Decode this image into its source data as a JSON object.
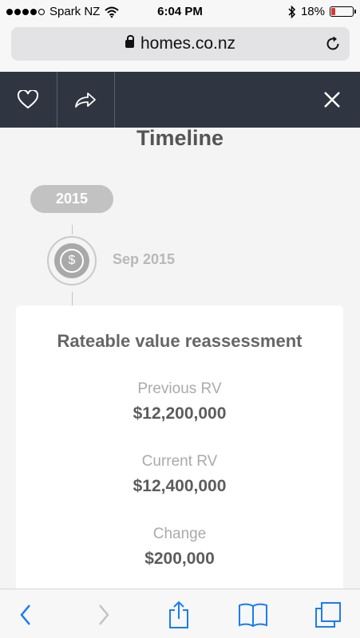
{
  "status": {
    "carrier": "Spark NZ",
    "time": "6:04 PM",
    "battery_percent": "18%",
    "battery_level": 0.18,
    "battery_color": "#e33333"
  },
  "browser": {
    "url": "homes.co.nz"
  },
  "header": {
    "background": "#2f3641",
    "icons": [
      "heart-icon",
      "share-icon",
      "close-icon"
    ]
  },
  "timeline": {
    "title": "Timeline",
    "year": "2015",
    "event_date": "Sep 2015",
    "event_icon": "dollar-coin-icon"
  },
  "card": {
    "title": "Rateable value reassessment",
    "rows": [
      {
        "label": "Previous RV",
        "value": "$12,200,000"
      },
      {
        "label": "Current RV",
        "value": "$12,400,000"
      },
      {
        "label": "Change",
        "value": "$200,000"
      }
    ]
  },
  "toolbar": {
    "icons": [
      "back-icon",
      "forward-icon",
      "share-icon",
      "bookmarks-icon",
      "tabs-icon"
    ],
    "accent": "#1a7cf5"
  }
}
